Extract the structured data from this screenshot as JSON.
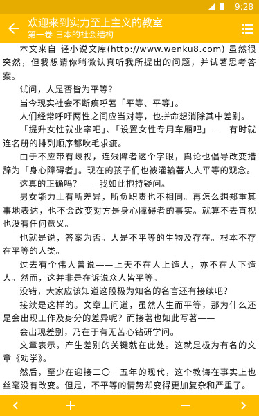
{
  "status": {
    "time": "9:28"
  },
  "header": {
    "title": "欢迎来到实力至上主义的教室",
    "subtitle": "第一卷 日本的社会结构"
  },
  "content": {
    "paragraphs": [
      "本文来自 轻小说文库(http://www.wenku8.com) 虽然很突然，但我想请你稍微认真听我所提出的问题，并试著思考答案。",
      "试问，人是否皆为平等？",
      "当今现实社会不断疾呼著「平等、平等」。",
      "人们经常呼吁两性之间应当对等，也拼命想消除其中差别。",
      "「提升女性就业率吧」、「设置女性专用车厢吧」——有时就连名册的排列顺序都吹毛求疵。",
      "由于不应带有歧视，连残障者这个字眼，舆论也倡导改变措辞为「身心障碍者」。现在的孩子们也被灌输著人人平等的观念。",
      "这真的正确吗？——我如此抱持疑问。",
      "男女能力上有所差异，所负职责也不相同。再怎么想郑重其事地表达，也不会改变对方是身心障碍者的事实。就算不去直视也没有任何意义。",
      "也就是说，答案为否。人是不平等的生物及存在。根本不存在平等的人类。",
      "过去有个伟人曾说——上天不在人上造人，亦不在人下造人。然而，这并非是在诉说众人皆平等。",
      "没错，大家应该知道这段极为知名的名言还有接续吧？",
      "接续是这样的。文章上问道，虽然人生而平等，那为什么还是会出现工作及身分的差异呢？而接著也如此写著——",
      "会出现差别，乃在于有无苦心钻研学问。",
      "文章表示，产生差别的关键就在此处。这就是极为有名的文章《劝学》。",
      "然后，至少在迎接二〇一五年的现代，这个教诲在事实上也丝毫没有改变。但是，不平等的情势却变得更加复杂和严重了。"
    ]
  },
  "icons": {
    "back": "arrow-left-icon",
    "menu": "list-menu-icon",
    "prev": "chevron-left-icon",
    "zoom_in": "plus-icon",
    "zoom_out": "minus-icon",
    "next": "chevron-right-icon"
  },
  "colors": {
    "toolbar": "#ffbf00",
    "statusbar": "#e6ac00"
  }
}
